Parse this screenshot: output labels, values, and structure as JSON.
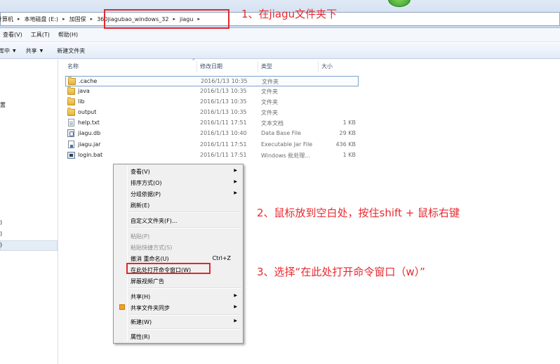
{
  "address": {
    "crumbs": [
      "计算机",
      "本地磁盘 (E:)",
      "加固保",
      "360jiagubao_windows_32",
      "jiagu"
    ]
  },
  "menubar": {
    "items": [
      "查看(V)",
      "工具(T)",
      "帮助(H)"
    ]
  },
  "toolbar": {
    "include_library": "库中",
    "share": "共享",
    "new_folder": "新建文件夹"
  },
  "navpane": {
    "fragments": [
      "置",
      ")",
      ")",
      ")"
    ]
  },
  "columns": {
    "name": "名称",
    "date": "修改日期",
    "type": "类型",
    "size": "大小"
  },
  "files": [
    {
      "name": ".cache",
      "date": "2016/1/13 10:35",
      "type": "文件夹",
      "size": "",
      "icon": "folder-icon"
    },
    {
      "name": "java",
      "date": "2016/1/13 10:35",
      "type": "文件夹",
      "size": "",
      "icon": "folder-icon"
    },
    {
      "name": "lib",
      "date": "2016/1/13 10:35",
      "type": "文件夹",
      "size": "",
      "icon": "folder-icon"
    },
    {
      "name": "output",
      "date": "2016/1/13 10:35",
      "type": "文件夹",
      "size": "",
      "icon": "folder-icon"
    },
    {
      "name": "help.txt",
      "date": "2016/1/11 17:51",
      "type": "文本文档",
      "size": "1 KB",
      "icon": "text-file-icon"
    },
    {
      "name": "jiagu.db",
      "date": "2016/1/13 10:40",
      "type": "Data Base File",
      "size": "29 KB",
      "icon": "database-file-icon"
    },
    {
      "name": "jiagu.jar",
      "date": "2016/1/11 17:51",
      "type": "Executable Jar File",
      "size": "436 KB",
      "icon": "jar-file-icon"
    },
    {
      "name": "login.bat",
      "date": "2016/1/11 17:51",
      "type": "Windows 批处理...",
      "size": "1 KB",
      "icon": "batch-file-icon"
    }
  ],
  "context_menu": {
    "view": "查看(V)",
    "sort_by": "排序方式(O)",
    "group_by": "分组依据(P)",
    "refresh": "刷新(E)",
    "customize_folder": "自定义文件夹(F)...",
    "paste": "粘贴(P)",
    "paste_shortcut": "粘贴快捷方式(S)",
    "undo_rename": "撤消 重命名(U)",
    "undo_shortcut": "Ctrl+Z",
    "open_cmd_here": "在此处打开命令窗口(W)",
    "block_video_ads": "屏蔽视频广告",
    "share_with": "共享(H)",
    "sync_shared_folder": "共享文件夹同步",
    "new": "新建(W)",
    "properties": "属性(R)"
  },
  "annotations": {
    "step1": "1、在jiagu文件夹下",
    "step2": "2、鼠标放到空白处，按住shift +  鼠标右键",
    "step3": "3、选择“在此处打开命令窗口（w）”"
  },
  "colors": {
    "annotation_red": "#e8282e",
    "selection_blue": "#7da2ce"
  }
}
